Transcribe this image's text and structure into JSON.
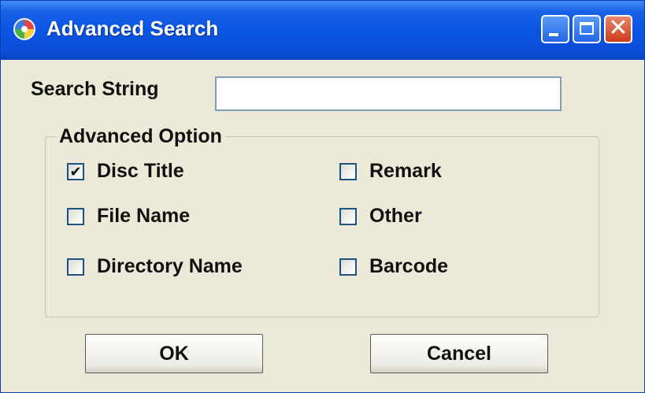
{
  "window": {
    "title": "Advanced Search",
    "close_glyph": "✕"
  },
  "search": {
    "label": "Search String",
    "value": ""
  },
  "options": {
    "group_label": "Advanced Option",
    "items": [
      {
        "label": "Disc Title",
        "checked": true
      },
      {
        "label": "File Name",
        "checked": false
      },
      {
        "label": "Directory Name",
        "checked": false
      },
      {
        "label": "Remark",
        "checked": false
      },
      {
        "label": "Other",
        "checked": false
      },
      {
        "label": "Barcode",
        "checked": false
      }
    ]
  },
  "buttons": {
    "ok_label": "OK",
    "cancel_label": "Cancel"
  }
}
